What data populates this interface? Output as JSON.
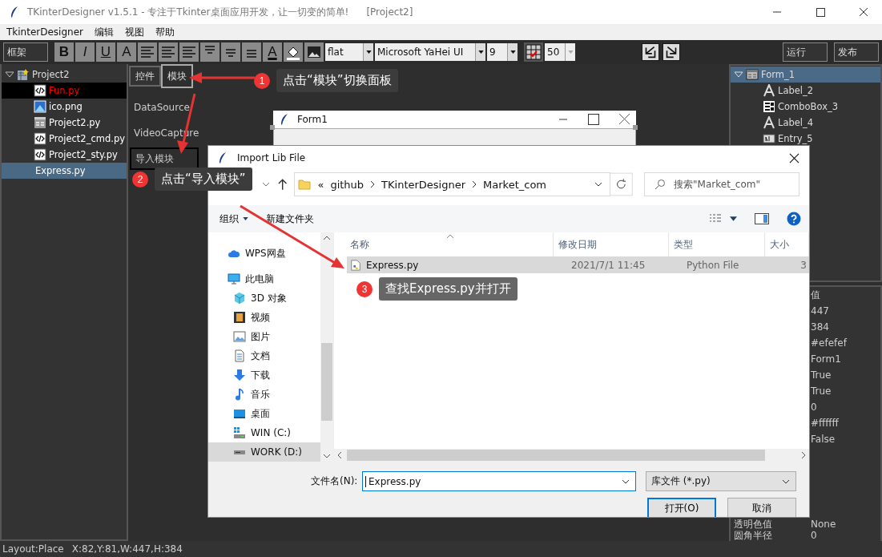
{
  "window": {
    "title": "TKinterDesigner v1.5.1 - 专注于Tkinter桌面应用开发，让一切变的简单!",
    "project": "[Project2]"
  },
  "menu": [
    "TkinterDesigner",
    "编辑",
    "视图",
    "帮助"
  ],
  "toolbar": {
    "frame_button": "框架",
    "format_buttons": [
      {
        "label": "B",
        "kind": "bold"
      },
      {
        "label": "I",
        "kind": "italic"
      },
      {
        "label": "U",
        "kind": "underline"
      },
      {
        "label": "A",
        "kind": "plain"
      }
    ],
    "text_color_button": "A",
    "relief": "flat",
    "font": "Microsoft YaHei UI",
    "font_size": "9",
    "grid_size": "50",
    "run_button": "运行",
    "publish_button": "发布"
  },
  "project_tree": {
    "name": "Project2",
    "expanded": true,
    "children": [
      {
        "name": "Fun.py",
        "kind": "code",
        "active": true,
        "selected": false,
        "color": "#ff0000"
      },
      {
        "name": "ico.png",
        "kind": "image",
        "active": false,
        "selected": false,
        "color": "#ffffff"
      },
      {
        "name": "Project2.py",
        "kind": "form",
        "active": false,
        "selected": false,
        "color": "#ffffff"
      },
      {
        "name": "Project2_cmd.py",
        "kind": "code",
        "active": false,
        "selected": false,
        "color": "#ffffff"
      },
      {
        "name": "Project2_sty.py",
        "kind": "code",
        "active": false,
        "selected": false,
        "color": "#ffffff"
      },
      {
        "name": "Express.py",
        "kind": "plain",
        "active": false,
        "selected": true,
        "color": "#ffffff"
      }
    ]
  },
  "panel_tabs": [
    {
      "label": "控件",
      "selected": false
    },
    {
      "label": "模块",
      "selected": true
    }
  ],
  "modules": [
    {
      "label": "DataSource",
      "selected": false
    },
    {
      "label": "VideoCapture",
      "selected": false
    },
    {
      "label": "导入模块",
      "selected": true
    }
  ],
  "form_window": {
    "title": "Form1"
  },
  "widget_tree": {
    "name": "Form_1",
    "expanded": true,
    "selected": true,
    "children": [
      {
        "name": "Label_2",
        "kind": "label"
      },
      {
        "name": "ComboBox_3",
        "kind": "combobox"
      },
      {
        "name": "Label_4",
        "kind": "label"
      },
      {
        "name": "Entry_5",
        "kind": "entry"
      }
    ]
  },
  "properties": {
    "value_header": "值",
    "rows": [
      {
        "value": "447"
      },
      {
        "value": "384"
      },
      {
        "value": "#efefef"
      },
      {
        "value": "Form1"
      },
      {
        "value": "True"
      },
      {
        "value": "True"
      },
      {
        "value": "0"
      },
      {
        "value": "#ffffff"
      },
      {
        "value": "False"
      },
      {
        "name": "透明色值",
        "value": "None"
      },
      {
        "name": "圆角半径",
        "value": "0"
      }
    ]
  },
  "dialog": {
    "title": "Import Lib File",
    "path": [
      "«",
      "github",
      "TKinterDesigner",
      "Market_com"
    ],
    "search": {
      "placeholder": "搜索\"Market_com\""
    },
    "organize": "组织",
    "new_folder": "新建文件夹",
    "nav": [
      {
        "label": "WPS网盘",
        "kind": "cloud",
        "selected": false
      },
      {
        "label": "此电脑",
        "kind": "pc",
        "selected": false,
        "children": [
          {
            "label": "3D 对象",
            "kind": "cube",
            "selected": false
          },
          {
            "label": "视频",
            "kind": "video",
            "selected": false
          },
          {
            "label": "图片",
            "kind": "pictures",
            "selected": false
          },
          {
            "label": "文档",
            "kind": "document",
            "selected": false
          },
          {
            "label": "下载",
            "kind": "download",
            "selected": false
          },
          {
            "label": "音乐",
            "kind": "music",
            "selected": false
          },
          {
            "label": "桌面",
            "kind": "desktop",
            "selected": false
          },
          {
            "label": "WIN (C:)",
            "kind": "windrive",
            "selected": false
          },
          {
            "label": "WORK (D:)",
            "kind": "drive",
            "selected": true
          }
        ]
      }
    ],
    "columns": [
      "名称",
      "修改日期",
      "类型",
      "大小"
    ],
    "files": [
      {
        "name": "Express.py",
        "modified": "2021/7/1 11:45",
        "type": "Python File",
        "size": "3",
        "selected": true
      }
    ],
    "file_name_label": "文件名(N):",
    "file_name": "Express.py",
    "filter": "库文件 (*.py)",
    "open_button": "打开(O)",
    "cancel_button": "取消"
  },
  "annotations": [
    {
      "number": "1",
      "text": "点击“模块”切换面板"
    },
    {
      "number": "2",
      "text": "点击“导入模块”"
    },
    {
      "number": "3",
      "text": "查找Express.py并打开"
    }
  ],
  "status_bar": {
    "layout": "Layout:Place",
    "geometry": "X:82,Y:81,W:447,H:384"
  }
}
